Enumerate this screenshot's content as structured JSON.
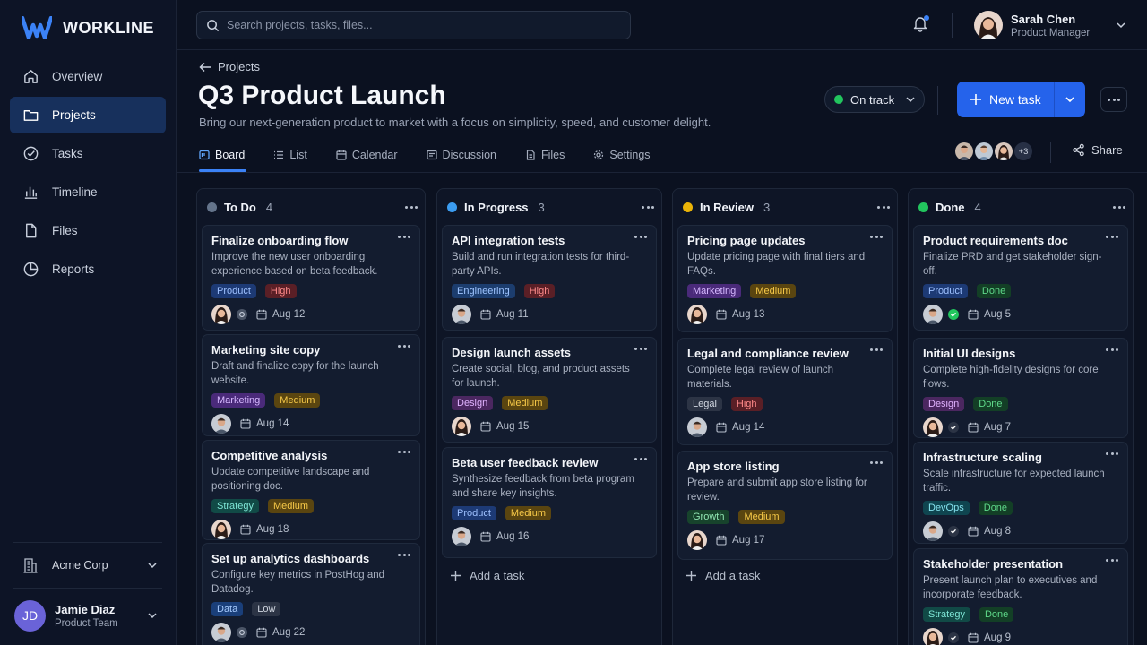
{
  "brand": {
    "name": "WORKLINE",
    "accent": "#2563eb"
  },
  "sidebar": {
    "items": [
      {
        "label": "Overview",
        "icon": "home-icon"
      },
      {
        "label": "Projects",
        "icon": "folder-icon",
        "active": true
      },
      {
        "label": "Tasks",
        "icon": "check-circle-icon"
      },
      {
        "label": "Timeline",
        "icon": "bar-chart-icon"
      },
      {
        "label": "Files",
        "icon": "file-icon"
      },
      {
        "label": "Reports",
        "icon": "pie-chart-icon"
      }
    ],
    "org": "Acme Corp",
    "user": {
      "initials": "JD",
      "name": "Jamie Diaz",
      "team": "Product Team"
    }
  },
  "topbar": {
    "search_placeholder": "Search projects, tasks, files...",
    "user": {
      "name": "Sarah Chen",
      "role": "Product Manager"
    }
  },
  "header": {
    "back_label": "Projects",
    "title": "Q3 Product Launch",
    "subtitle": "Bring our next-generation product to market with a focus on simplicity, speed, and customer delight.",
    "status": "On track",
    "new_task_label": "New task",
    "member_extra": "+3",
    "share_label": "Share",
    "tabs": [
      {
        "label": "Board",
        "icon": "board-icon",
        "active": true
      },
      {
        "label": "List",
        "icon": "list-icon"
      },
      {
        "label": "Calendar",
        "icon": "calendar-icon"
      },
      {
        "label": "Discussion",
        "icon": "chat-icon"
      },
      {
        "label": "Files",
        "icon": "file-icon"
      },
      {
        "label": "Settings",
        "icon": "gear-icon"
      }
    ]
  },
  "board": {
    "add_task_label": "Add a task",
    "columns": [
      {
        "title": "To Do",
        "count": "4",
        "color": "#64748b",
        "cards": [
          {
            "title": "Finalize onboarding flow",
            "desc": "Improve the new user onboarding experience based on beta feedback.",
            "tags": [
              "Product",
              "High"
            ],
            "date": "Aug 12"
          },
          {
            "title": "Marketing site copy",
            "desc": "Draft and finalize copy for the launch website.",
            "tags": [
              "Marketing",
              "Medium"
            ],
            "date": "Aug 14"
          },
          {
            "title": "Competitive analysis",
            "desc": "Update competitive landscape and positioning doc.",
            "tags": [
              "Strategy",
              "Medium"
            ],
            "date": "Aug 18"
          },
          {
            "title": "Set up analytics dashboards",
            "desc": "Configure key metrics in PostHog and Datadog.",
            "tags": [
              "Data",
              "Low"
            ],
            "date": "Aug 22"
          }
        ]
      },
      {
        "title": "In Progress",
        "count": "3",
        "color": "#3b9cf0",
        "cards": [
          {
            "title": "API integration tests",
            "desc": "Build and run integration tests for third-party APIs.",
            "tags": [
              "Engineering",
              "High"
            ],
            "date": "Aug 11"
          },
          {
            "title": "Design launch assets",
            "desc": "Create social, blog, and product assets for launch.",
            "tags": [
              "Design",
              "Medium"
            ],
            "date": "Aug 15"
          },
          {
            "title": "Beta user feedback review",
            "desc": "Synthesize feedback from beta program and share key insights.",
            "tags": [
              "Product",
              "Medium"
            ],
            "date": "Aug 16"
          }
        ]
      },
      {
        "title": "In Review",
        "count": "3",
        "color": "#eab308",
        "cards": [
          {
            "title": "Pricing page updates",
            "desc": "Update pricing page with final tiers and FAQs.",
            "tags": [
              "Marketing",
              "Medium"
            ],
            "date": "Aug 13"
          },
          {
            "title": "Legal and compliance review",
            "desc": "Complete legal review of launch materials.",
            "tags": [
              "Legal",
              "High"
            ],
            "date": "Aug 14"
          },
          {
            "title": "App store listing",
            "desc": "Prepare and submit app store listing for review.",
            "tags": [
              "Growth",
              "Medium"
            ],
            "date": "Aug 17"
          }
        ]
      },
      {
        "title": "Done",
        "count": "4",
        "color": "#22c55e",
        "cards": [
          {
            "title": "Product requirements doc",
            "desc": "Finalize PRD and get stakeholder sign-off.",
            "tags": [
              "Product",
              "Done"
            ],
            "date": "Aug 5"
          },
          {
            "title": "Initial UI designs",
            "desc": "Complete high-fidelity designs for core flows.",
            "tags": [
              "Design",
              "Done"
            ],
            "date": "Aug 7"
          },
          {
            "title": "Infrastructure scaling",
            "desc": "Scale infrastructure for expected launch traffic.",
            "tags": [
              "DevOps",
              "Done"
            ],
            "date": "Aug 8"
          },
          {
            "title": "Stakeholder presentation",
            "desc": "Present launch plan to executives and incorporate feedback.",
            "tags": [
              "Strategy",
              "Done"
            ],
            "date": "Aug 9"
          }
        ]
      }
    ]
  }
}
